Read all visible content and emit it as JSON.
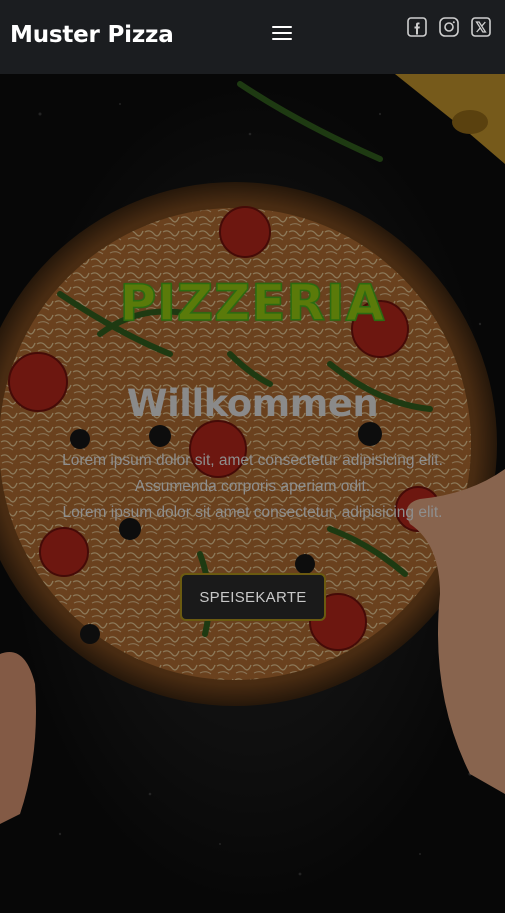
{
  "header": {
    "brand": "Muster Pizza",
    "socials": [
      {
        "icon": "facebook-icon"
      },
      {
        "icon": "instagram-icon"
      },
      {
        "icon": "x-twitter-icon"
      }
    ]
  },
  "hero": {
    "title": "PIZZERIA",
    "subtitle": "Willkommen",
    "text_lines": [
      "Lorem ipsum dolor sit, amet consectetur adipisicing elit.",
      "Assumenda corporis aperiam odit.",
      "Lorem ipsum dolor sit amet consectetur, adipisicing elit."
    ],
    "cta_label": "SPEISEKARTE"
  },
  "colors": {
    "header_bg": "#1b1d20",
    "title_green": "#2c6b12",
    "cta_border": "#6b5a10"
  }
}
